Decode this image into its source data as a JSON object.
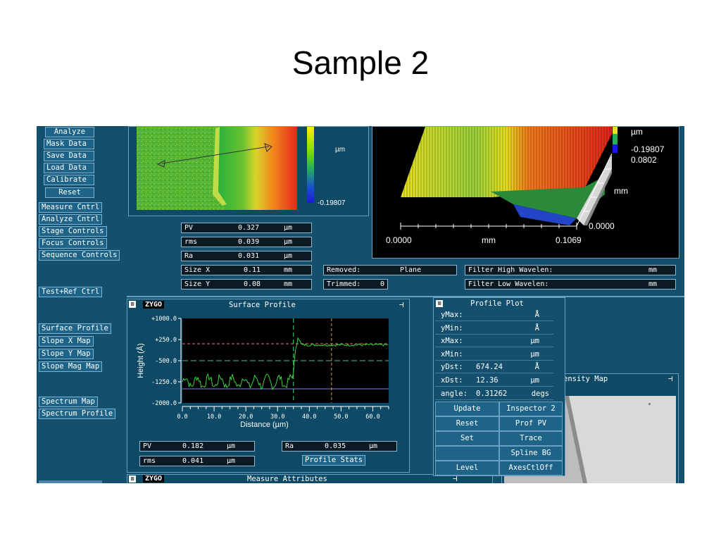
{
  "slide": {
    "title": "Sample 2"
  },
  "left_menu": {
    "buttons": [
      "Analyze",
      "Mask Data",
      "Save Data",
      "Load Data",
      "Calibrate",
      "Reset"
    ],
    "controls": [
      "Measure Cntrl",
      "Analyze Cntrl",
      "Stage Controls",
      "Focus Controls",
      "Sequence Controls"
    ],
    "test_ref": "Test+Ref Ctrl",
    "maps": [
      "Surface Profile",
      "Slope X Map",
      "Slope Y Map",
      "Slope Mag Map"
    ],
    "spectrum": [
      "Spectrum Map",
      "Spectrum Profile"
    ]
  },
  "map2d": {
    "unit": "µm",
    "min_label": "-0.19807"
  },
  "stats": [
    {
      "label": "PV",
      "value": "0.327",
      "unit": "µm"
    },
    {
      "label": "rms",
      "value": "0.039",
      "unit": "µm"
    },
    {
      "label": "Ra",
      "value": "0.031",
      "unit": "µm"
    },
    {
      "label": "Size X",
      "value": "0.11",
      "unit": "mm"
    },
    {
      "label": "Size Y",
      "value": "0.08",
      "unit": "mm"
    }
  ],
  "removed": {
    "label": "Removed:",
    "value": "Plane"
  },
  "trimmed": {
    "label": "Trimmed:",
    "value": "0"
  },
  "filter_high": {
    "label": "Filter High Wavelen:",
    "unit": "mm"
  },
  "filter_low": {
    "label": "Filter Low  Wavelen:",
    "unit": "mm"
  },
  "plot3d": {
    "unit": "µm",
    "zmin": "-0.19807",
    "y_max": "0.0802",
    "y_unit": "mm",
    "y_zero": "0.0000",
    "x_min": "0.0000",
    "x_unit": "mm",
    "x_max": "0.1069"
  },
  "surface_profile": {
    "title": "Surface Profile",
    "logo": "ZYGO",
    "ylabel": "Height (Å)",
    "xlabel": "Distance (µm)",
    "yticks": [
      "+1000.0",
      "+250.0",
      "-500.0",
      "-1250.0",
      "-2000.0"
    ],
    "xticks": [
      "0.0",
      "10.0",
      "20.0",
      "30.0",
      "40.0",
      "50.0",
      "60.0"
    ],
    "pv": {
      "label": "PV",
      "value": "0.182",
      "unit": "µm"
    },
    "rms": {
      "label": "rms",
      "value": "0.041",
      "unit": "µm"
    },
    "ra": {
      "label": "Ra",
      "value": "0.035",
      "unit": "µm"
    },
    "stats_button": "Profile Stats"
  },
  "profile_plot": {
    "title": "Profile Plot",
    "rows": [
      {
        "label": "yMax:",
        "value": "",
        "unit": "Å"
      },
      {
        "label": "yMin:",
        "value": "",
        "unit": "Å"
      },
      {
        "label": "xMax:",
        "value": "",
        "unit": "µm"
      },
      {
        "label": "xMin:",
        "value": "",
        "unit": "µm"
      },
      {
        "label": "yDst:",
        "value": "674.24",
        "unit": "Å"
      },
      {
        "label": "xDst:",
        "value": "12.36",
        "unit": "µm"
      },
      {
        "label": "angle:",
        "value": "0.31262",
        "unit": "degs"
      }
    ],
    "buttons": [
      "Update",
      "Inspector 2",
      "Reset",
      "Prof PV",
      "Set",
      "Trace",
      "",
      "Spline BG",
      "Level",
      "AxesCtlOff"
    ]
  },
  "intensity_map": {
    "title": "ensity Map"
  },
  "measure_attributes": {
    "title": "Measure Attributes",
    "logo": "ZYGO"
  }
}
